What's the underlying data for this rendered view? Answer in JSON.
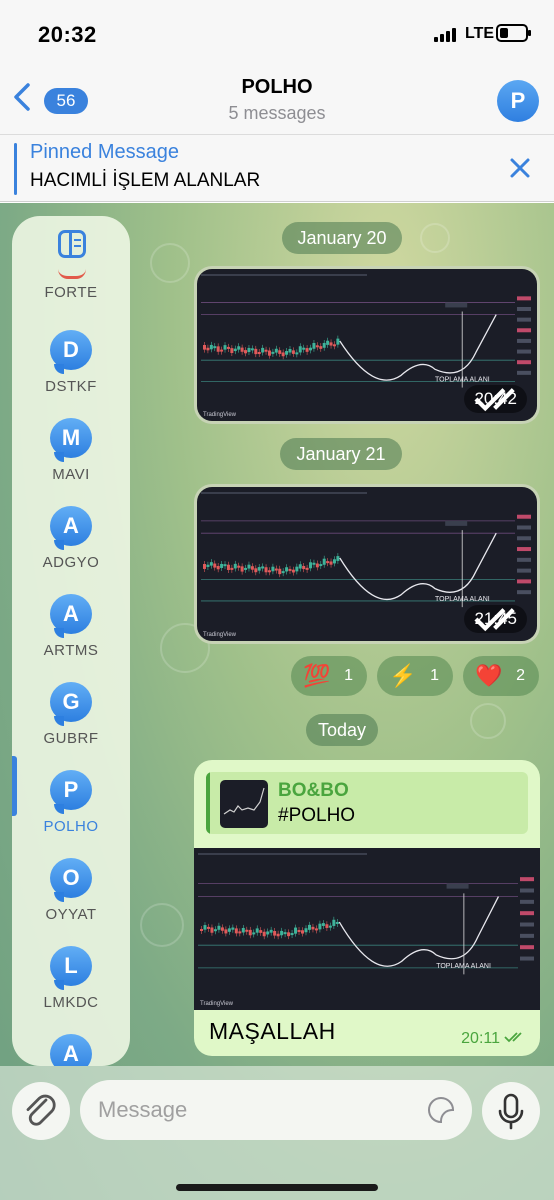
{
  "status": {
    "time": "20:32",
    "network": "LTE",
    "battery_fraction": 0.35
  },
  "header": {
    "back_count": "56",
    "title": "POLHO",
    "subtitle": "5 messages",
    "avatar_letter": "P"
  },
  "pinned": {
    "title": "Pinned Message",
    "text": "HACIMLİ İŞLEM ALANLAR"
  },
  "sidebar": {
    "items": [
      {
        "label": "FORTE",
        "letter": ""
      },
      {
        "label": "DSTKF",
        "letter": "D"
      },
      {
        "label": "MAVI",
        "letter": "M"
      },
      {
        "label": "ADGYO",
        "letter": "A"
      },
      {
        "label": "ARTMS",
        "letter": "A"
      },
      {
        "label": "GUBRF",
        "letter": "G"
      },
      {
        "label": "POLHO",
        "letter": "P",
        "active": true
      },
      {
        "label": "OYYAT",
        "letter": "O"
      },
      {
        "label": "LMKDC",
        "letter": "L"
      },
      {
        "label": "",
        "letter": "A"
      }
    ]
  },
  "messages": {
    "date1": "January 20",
    "msg1": {
      "time": "20:42",
      "chart_label": "TOPLAMA ALANI",
      "brand": "TradingView"
    },
    "date2": "January 21",
    "msg2": {
      "time": "21:45",
      "chart_label": "TOPLAMA ALANI",
      "brand": "TradingView"
    },
    "reactions": [
      {
        "emoji": "💯",
        "count": "1"
      },
      {
        "emoji": "⚡",
        "count": "1"
      },
      {
        "emoji": "❤️",
        "count": "2"
      }
    ],
    "date3": "Today",
    "msg3": {
      "reply_name": "BO&BO",
      "reply_text": "#POLHO",
      "chart_label": "TOPLAMA ALANI",
      "brand": "TradingView",
      "text": "MAŞALLAH",
      "time": "20:11"
    }
  },
  "input": {
    "placeholder": "Message"
  },
  "colors": {
    "accent": "#3a82dd",
    "outgoing_bubble": "#e0f8c8",
    "outgoing_time": "#4aa53e",
    "chart_bg": "#1b1d27"
  }
}
